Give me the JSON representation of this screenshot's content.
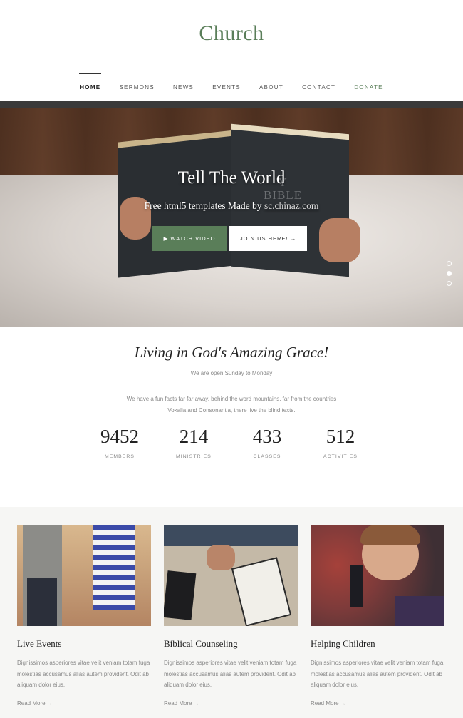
{
  "header": {
    "logo": "Church"
  },
  "nav": {
    "items": [
      {
        "label": "HOME"
      },
      {
        "label": "SERMONS"
      },
      {
        "label": "NEWS"
      },
      {
        "label": "EVENTS"
      },
      {
        "label": "ABOUT"
      },
      {
        "label": "CONTACT"
      },
      {
        "label": "DONATE"
      }
    ]
  },
  "hero": {
    "title": "Tell The World",
    "subtitle": "Free html5 templates Made by ",
    "subtitle_link": "sc.chinaz.com",
    "book_text_line1": "Y",
    "book_text_line2": "BIBLE",
    "watch_button": "▶  WATCH VIDEO",
    "join_button": "JOIN US HERE! →",
    "slider_dots": 3
  },
  "grace": {
    "title": "Living in God's Amazing Grace!",
    "subtitle": "We are open Sunday to Monday",
    "text": "We have a fun facts far far away, behind the word mountains, far from the countries Vokalia and Consonantia, there live the blind texts.",
    "stats": [
      {
        "value": "9452",
        "label": "MEMBERS"
      },
      {
        "value": "214",
        "label": "MINISTRIES"
      },
      {
        "value": "433",
        "label": "CLASSES"
      },
      {
        "value": "512",
        "label": "ACTIVITIES"
      }
    ]
  },
  "cards": [
    {
      "title": "Live Events",
      "text": "Dignissimos asperiores vitae velit veniam totam fuga molestias accusamus alias autem provident. Odit ab aliquam dolor eius.",
      "link": "Read More →"
    },
    {
      "title": "Biblical Counseling",
      "text": "Dignissimos asperiores vitae velit veniam totam fuga molestias accusamus alias autem provident. Odit ab aliquam dolor eius.",
      "link": "Read More →"
    },
    {
      "title": "Helping Children",
      "text": "Dignissimos asperiores vitae velit veniam totam fuga molestias accusamus alias autem provident. Odit ab aliquam dolor eius.",
      "link": "Read More →"
    }
  ],
  "colors": {
    "accent": "#5a7e59",
    "strip": "#3a3a3a",
    "cards_bg": "#f6f6f4"
  }
}
